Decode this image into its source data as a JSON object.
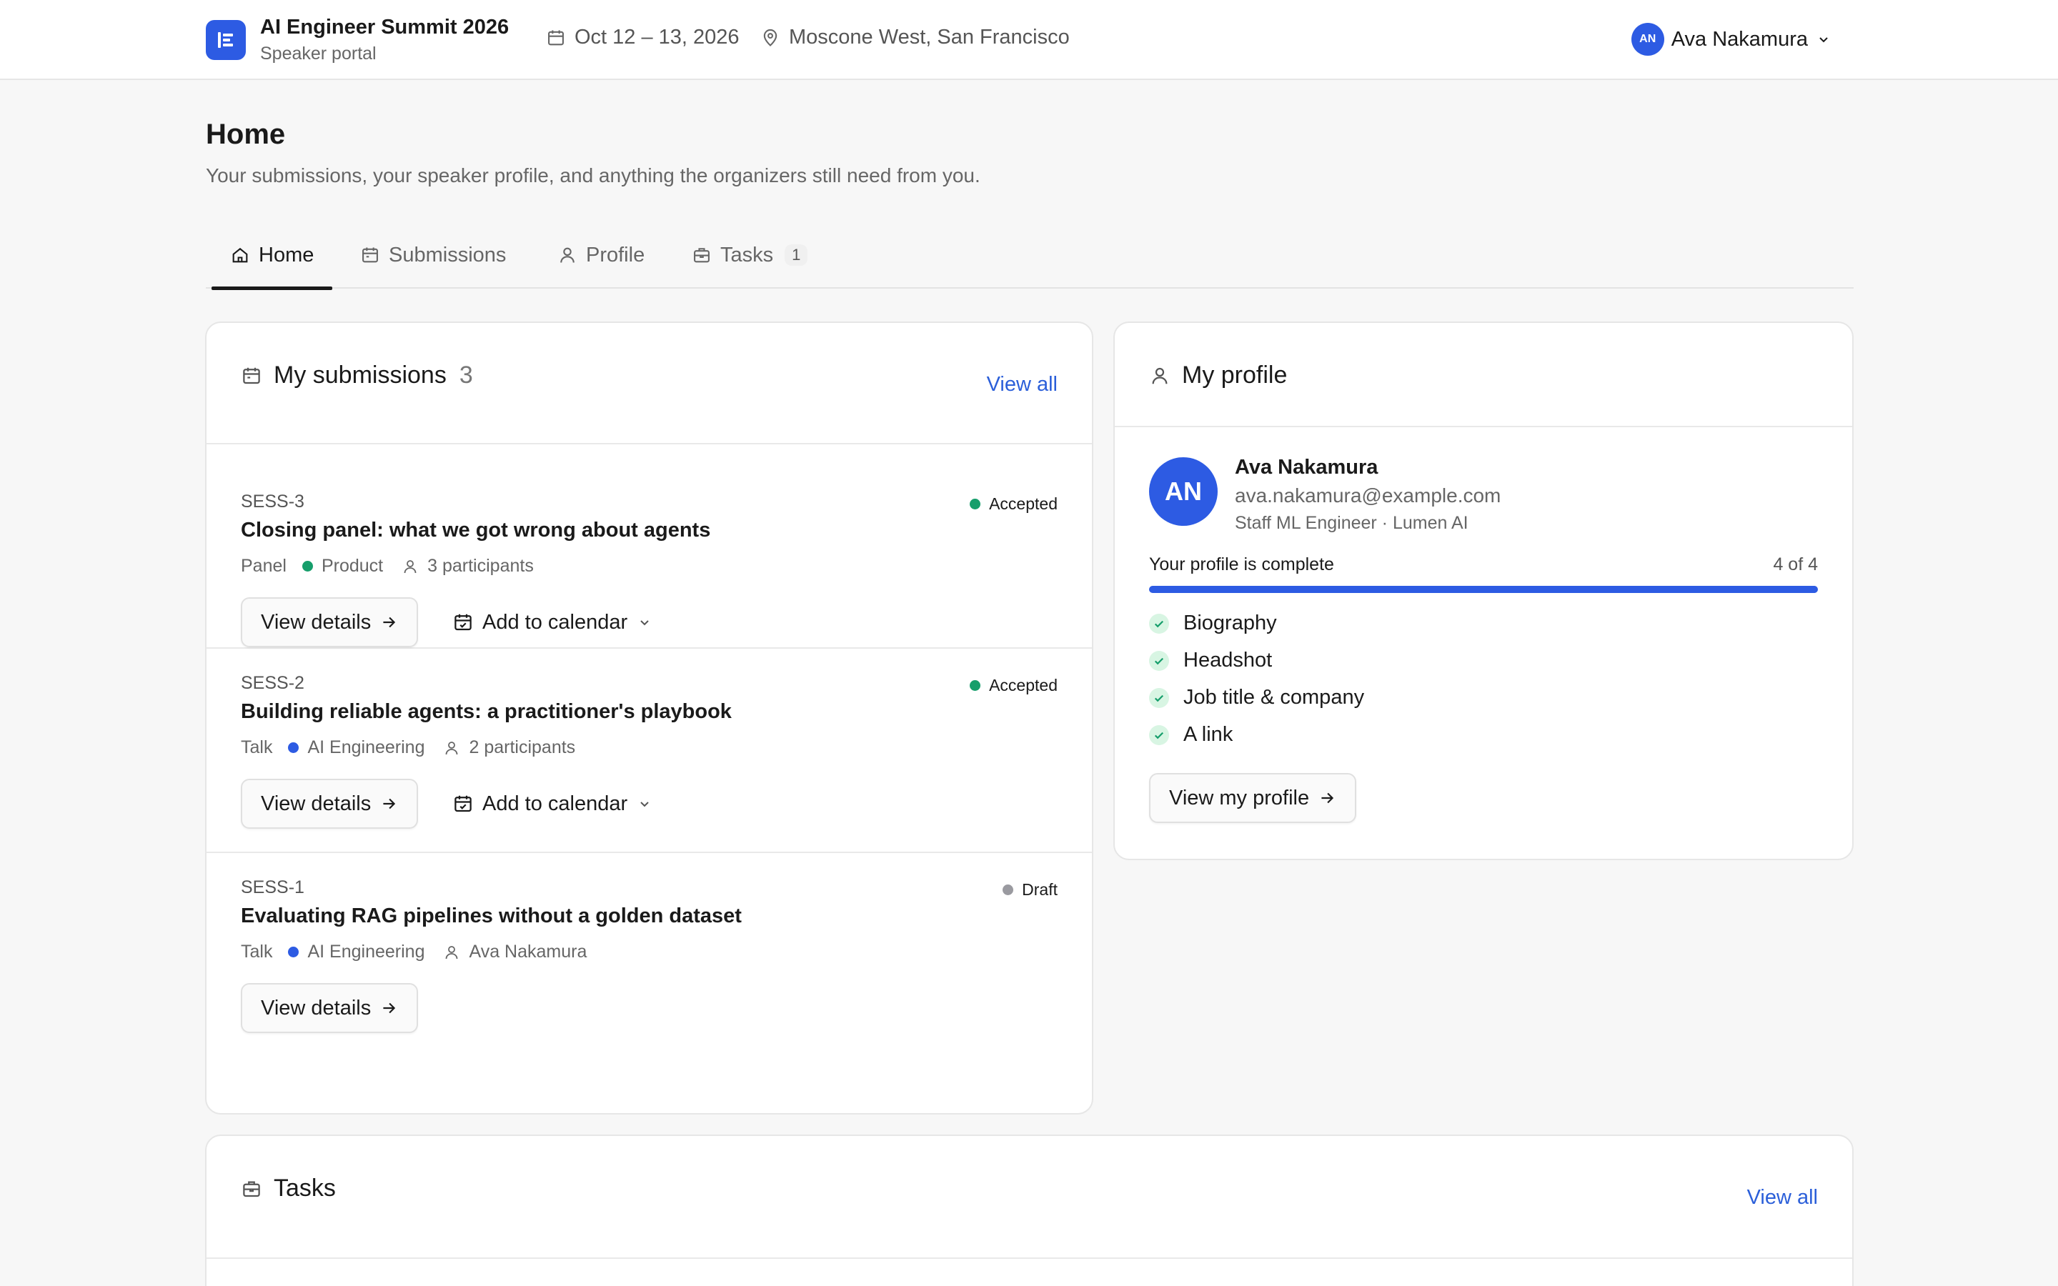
{
  "header": {
    "event_title": "AI Engineer Summit 2026",
    "portal_label": "Speaker portal",
    "dates": "Oct 12 – 13, 2026",
    "location": "Moscone West, San Francisco",
    "user": {
      "initials": "AN",
      "name": "Ava Nakamura"
    }
  },
  "page": {
    "title": "Home",
    "subtitle": "Your submissions, your speaker profile, and anything the organizers still need from you."
  },
  "tabs": [
    {
      "label": "Home",
      "icon": "home-icon",
      "active": true
    },
    {
      "label": "Submissions",
      "icon": "calendar-icon"
    },
    {
      "label": "Profile",
      "icon": "person-icon"
    },
    {
      "label": "Tasks",
      "icon": "briefcase-icon",
      "count": "1"
    }
  ],
  "submissions": {
    "title": "My submissions",
    "count": "3",
    "view_all": "View all",
    "view_details_label": "View details",
    "add_calendar_label": "Add to calendar",
    "items": [
      {
        "id": "SESS-3",
        "title": "Closing panel: what we got wrong about agents",
        "format": "Panel",
        "track": "Product",
        "track_color": "#169e6b",
        "people": "3 participants",
        "status": "Accepted",
        "status_color": "#169e6b"
      },
      {
        "id": "SESS-2",
        "title": "Building reliable agents: a practitioner's playbook",
        "format": "Talk",
        "track": "AI Engineering",
        "track_color": "#2d5be3",
        "people": "2 participants",
        "status": "Accepted",
        "status_color": "#169e6b"
      },
      {
        "id": "SESS-1",
        "title": "Evaluating RAG pipelines without a golden dataset",
        "format": "Talk",
        "track": "AI Engineering",
        "track_color": "#2d5be3",
        "people": "Ava Nakamura",
        "status": "Draft",
        "status_color": "#9a9aa0"
      }
    ]
  },
  "profile": {
    "title": "My profile",
    "initials": "AN",
    "name": "Ava Nakamura",
    "email": "ava.nakamura@example.com",
    "role": "Staff ML Engineer · Lumen AI",
    "progress_label": "Your profile is complete",
    "progress_count": "4 of 4",
    "progress_fraction": 1.0,
    "checklist": [
      "Biography",
      "Headshot",
      "Job title & company",
      "A link"
    ],
    "button": "View my profile"
  },
  "tasks": {
    "title": "Tasks",
    "view_all": "View all"
  },
  "colors": {
    "accent": "#2d5be3",
    "link": "#2b5fd9",
    "success": "#169e6b"
  }
}
